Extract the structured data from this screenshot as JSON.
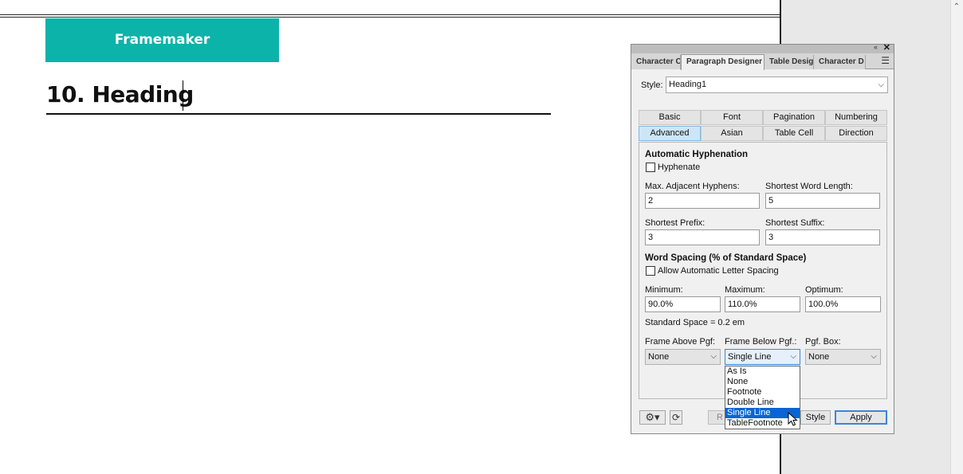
{
  "document": {
    "banner": "Framemaker",
    "heading": "10. Heading"
  },
  "panel": {
    "tabs": [
      "Character C",
      "Paragraph Designer",
      "Table Desig",
      "Character D"
    ],
    "active_tab": "Paragraph Designer",
    "style_label": "Style:",
    "style_value": "Heading1",
    "category_tabs_row1": [
      "Basic",
      "Font",
      "Pagination",
      "Numbering"
    ],
    "category_tabs_row2": [
      "Advanced",
      "Asian",
      "Table Cell",
      "Direction"
    ],
    "active_category": "Advanced",
    "hyphenation": {
      "title": "Automatic Hyphenation",
      "hyphenate_label": "Hyphenate",
      "hyphenate_checked": false,
      "max_adjacent_label": "Max. Adjacent Hyphens:",
      "max_adjacent_value": "2",
      "shortest_word_label": "Shortest Word Length:",
      "shortest_word_value": "5",
      "shortest_prefix_label": "Shortest Prefix:",
      "shortest_prefix_value": "3",
      "shortest_suffix_label": "Shortest Suffix:",
      "shortest_suffix_value": "3"
    },
    "word_spacing": {
      "title": "Word Spacing (% of Standard Space)",
      "allow_letter_spacing_label": "Allow Automatic Letter Spacing",
      "allow_letter_spacing_checked": false,
      "minimum_label": "Minimum:",
      "minimum_value": "90.0%",
      "maximum_label": "Maximum:",
      "maximum_value": "110.0%",
      "optimum_label": "Optimum:",
      "optimum_value": "100.0%",
      "standard_space_text": "Standard Space = 0.2 em"
    },
    "frames": {
      "above_label": "Frame Above Pgf:",
      "above_value": "None",
      "below_label": "Frame Below Pgf.:",
      "below_value": "Single Line",
      "box_label": "Pgf. Box:",
      "box_value": "None",
      "below_options": [
        "As Is",
        "None",
        "Footnote",
        "Double Line",
        "Single Line",
        "TableFootnote"
      ],
      "below_selected_option": "Single Line"
    },
    "buttons": {
      "reset_partial": "R",
      "style_partial": "Style",
      "apply": "Apply"
    }
  },
  "colors": {
    "banner": "#0cb3a9",
    "selection": "#0a64d2",
    "active_tab": "#cde6f7"
  },
  "icons": [
    "collapse-icon",
    "close-icon",
    "panel-menu-icon",
    "chevron-down-icon",
    "gear-icon",
    "refresh-icon",
    "mouse-pointer-icon",
    "scroll-up-arrow-icon"
  ]
}
